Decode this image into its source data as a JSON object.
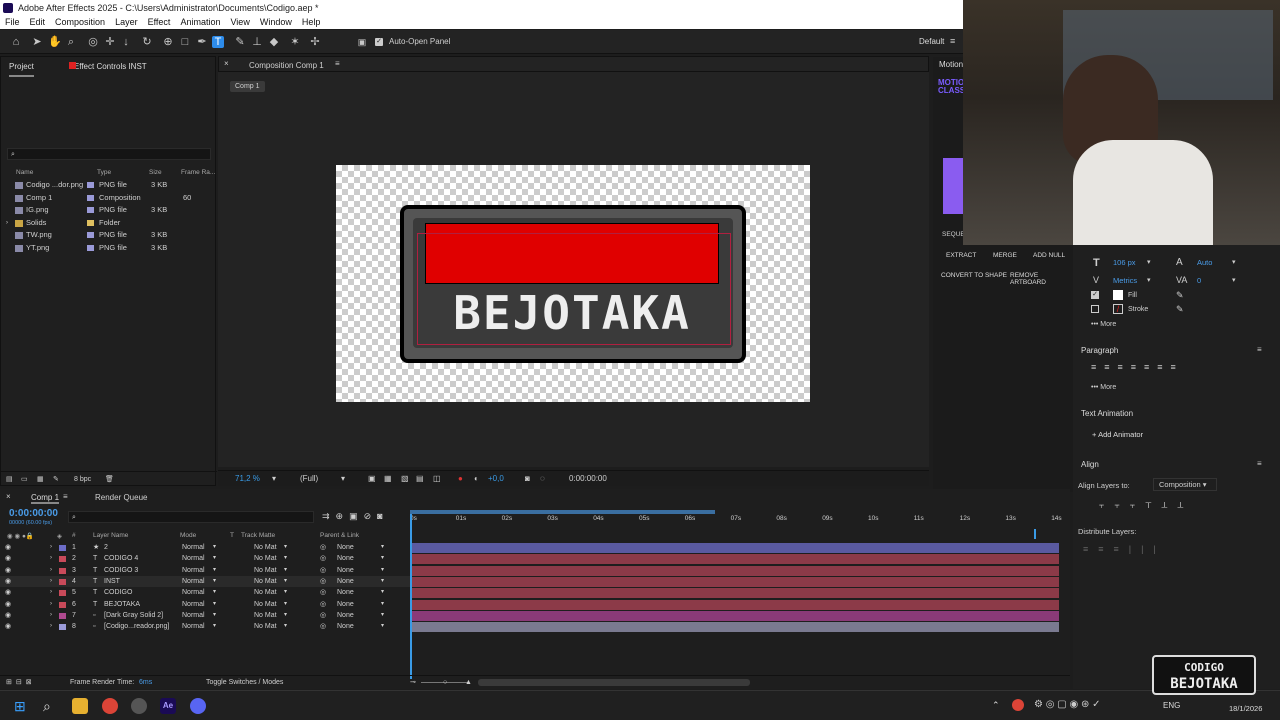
{
  "titlebar": {
    "title": "Adobe After Effects 2025 - C:\\Users\\Administrator\\Documents\\Codigo.aep *"
  },
  "menu": [
    "File",
    "Edit",
    "Composition",
    "Layer",
    "Effect",
    "Animation",
    "View",
    "Window",
    "Help"
  ],
  "toolbar": {
    "auto_open": "Auto-Open Panel",
    "workspace": "Default"
  },
  "project": {
    "tab_project": "Project",
    "tab_effect": "Effect Controls INST",
    "columns": [
      "Name",
      "Type",
      "Size",
      "Frame Ra..."
    ],
    "items": [
      {
        "name": "Codigo ...dor.png",
        "type": "PNG file",
        "size": "3 KB",
        "fr": "",
        "color": "#9a9ad8"
      },
      {
        "name": "Comp 1",
        "type": "Composition",
        "size": "",
        "fr": "60",
        "color": "#9a9ad8"
      },
      {
        "name": "IG.png",
        "type": "PNG file",
        "size": "3 KB",
        "fr": "",
        "color": "#9a9ad8"
      },
      {
        "name": "Solids",
        "type": "Folder",
        "size": "",
        "fr": "",
        "color": "#e0c060"
      },
      {
        "name": "TW.png",
        "type": "PNG file",
        "size": "3 KB",
        "fr": "",
        "color": "#9a9ad8"
      },
      {
        "name": "YT.png",
        "type": "PNG file",
        "size": "3 KB",
        "fr": "",
        "color": "#9a9ad8"
      }
    ],
    "bpc": "8 bpc"
  },
  "composition": {
    "tab": "Composition Comp 1",
    "crumb": "Comp 1",
    "badge_text": "BEJOTAKA",
    "zoom": "71,2 %",
    "quality": "(Full)",
    "exposure": "+0,0",
    "time": "0:00:00:00"
  },
  "motion": {
    "tab": "Motion",
    "title1": "MOTIO",
    "title2": "CLASS",
    "seq": "SEQUE",
    "extract": "EXTRACT",
    "merge": "MERGE",
    "add_null": "ADD NULL",
    "convert": "CONVERT TO SHAPE",
    "remove": "REMOVE ARTBOARD"
  },
  "character": {
    "size": "106 px",
    "auto": "Auto",
    "metrics": "Metrics",
    "tracking": "0",
    "fill": "Fill",
    "stroke": "Stroke",
    "more": "More"
  },
  "paragraph": {
    "title": "Paragraph",
    "more": "More"
  },
  "text_animation": {
    "title": "Text Animation",
    "add": "Add Animator"
  },
  "align": {
    "title": "Align",
    "align_to_label": "Align Layers to:",
    "align_to": "Composition",
    "distribute": "Distribute Layers:"
  },
  "timeline": {
    "tab": "Comp 1",
    "render_queue": "Render Queue",
    "timecode": "0:00:00:00",
    "fps": "00000 (60.00 fps)",
    "headers": [
      "#",
      "Layer Name",
      "Mode",
      "T",
      "Track Matte",
      "Parent & Link"
    ],
    "ruler": [
      "0s",
      "01s",
      "02s",
      "03s",
      "04s",
      "05s",
      "06s",
      "07s",
      "08s",
      "09s",
      "10s",
      "11s",
      "12s",
      "13s",
      "14s"
    ],
    "layers": [
      {
        "num": "1",
        "name": "2",
        "mode": "Normal",
        "matte": "No Mat",
        "parent": "None",
        "label": "#6d6dc8",
        "bar": "#5a5aa0"
      },
      {
        "num": "2",
        "name": "CODIGO 4",
        "mode": "Normal",
        "matte": "No Mat",
        "parent": "None",
        "label": "#c84a5a",
        "bar": "#8c3a48"
      },
      {
        "num": "3",
        "name": "CODIGO 3",
        "mode": "Normal",
        "matte": "No Mat",
        "parent": "None",
        "label": "#c84a5a",
        "bar": "#8c3a48"
      },
      {
        "num": "4",
        "name": "INST",
        "mode": "Normal",
        "matte": "No Mat",
        "parent": "None",
        "label": "#c84a5a",
        "bar": "#8c3a48"
      },
      {
        "num": "5",
        "name": "CODIGO",
        "mode": "Normal",
        "matte": "No Mat",
        "parent": "None",
        "label": "#c84a5a",
        "bar": "#8c3a48"
      },
      {
        "num": "6",
        "name": "BEJOTAKA",
        "mode": "Normal",
        "matte": "No Mat",
        "parent": "None",
        "label": "#c84a5a",
        "bar": "#8c3a48"
      },
      {
        "num": "7",
        "name": "[Dark Gray Solid 2]",
        "mode": "Normal",
        "matte": "No Mat",
        "parent": "None",
        "label": "#b04a90",
        "bar": "#8a3a78"
      },
      {
        "num": "8",
        "name": "[Codigo...reador.png]",
        "mode": "Normal",
        "matte": "No Mat",
        "parent": "None",
        "label": "#9a9ad8",
        "bar": "#7a7a90"
      }
    ],
    "frame_render": "Frame Render Time:",
    "frame_render_val": "6ms",
    "toggle": "Toggle Switches / Modes"
  },
  "taskbar": {
    "lang": "ENG",
    "time": "",
    "date": "18/1/2026"
  },
  "logo": {
    "line1": "CODIGO",
    "line2": "BEJOTAKA"
  }
}
